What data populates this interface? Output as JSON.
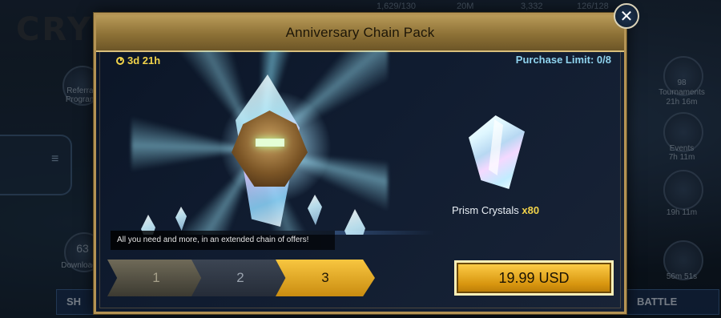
{
  "watermark": "CRYPTOVN",
  "background": {
    "resources": [
      "1,629/130",
      "20M",
      "3,332",
      "126/128"
    ],
    "side_labels": {
      "referral": "Referral Program",
      "tournaments_count": "98",
      "tournaments": "Tournaments",
      "tournaments_timer": "21h 16m",
      "events": "Events",
      "events_timer": "7h 11m",
      "right_timer": "19h 11m",
      "bottom_timer": "56m 51s",
      "downloads_count": "63",
      "downloads": "Downloads"
    },
    "bottom": {
      "shop": "SH",
      "battle": "BATTLE"
    }
  },
  "popup": {
    "title": "Anniversary Chain Pack",
    "timer": "3d 21h",
    "purchase_limit": "Purchase Limit: 0/8",
    "tagline": "All you need and more, in an extended chain of offers!",
    "reward": {
      "name": "Prism Crystals",
      "quantity": "x80",
      "icon": "prism-crystal-icon"
    },
    "steps": [
      {
        "label": "1",
        "state": "completed"
      },
      {
        "label": "2",
        "state": "completed"
      },
      {
        "label": "3",
        "state": "active"
      }
    ],
    "price": "19.99 USD",
    "close": "✕"
  },
  "colors": {
    "gold": "#f1d34a",
    "limit": "#8fd3ee",
    "frame": "#b49354",
    "buy": "#ffcf4a"
  }
}
